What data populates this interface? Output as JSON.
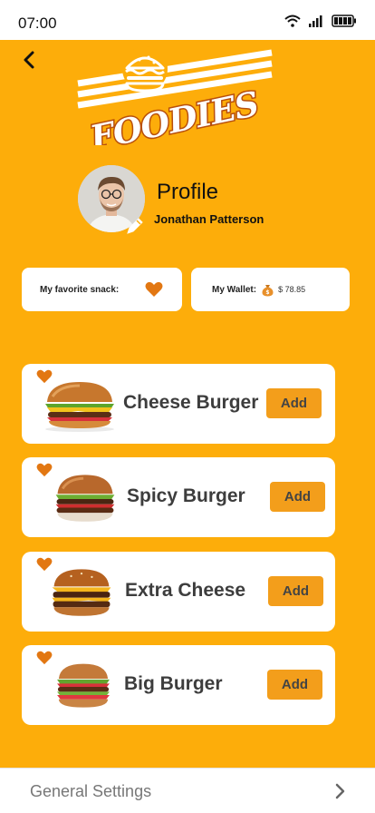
{
  "status_bar": {
    "time": "07:00"
  },
  "logo": {
    "text": "FOODIES"
  },
  "profile": {
    "title": "Profile",
    "name": "Jonathan Patterson"
  },
  "favorite": {
    "label": "My favorite snack:"
  },
  "wallet": {
    "label": "My Wallet:",
    "amount": "$ 78.85"
  },
  "food_items": [
    {
      "name": "Cheese Burger",
      "add_label": "Add"
    },
    {
      "name": "Spicy Burger",
      "add_label": "Add"
    },
    {
      "name": "Extra Cheese",
      "add_label": "Add"
    },
    {
      "name": "Big Burger",
      "add_label": "Add"
    }
  ],
  "settings": {
    "label": "General Settings"
  },
  "colors": {
    "background": "#fdad0a",
    "accent": "#f39e1b",
    "heart": "#e27712"
  }
}
